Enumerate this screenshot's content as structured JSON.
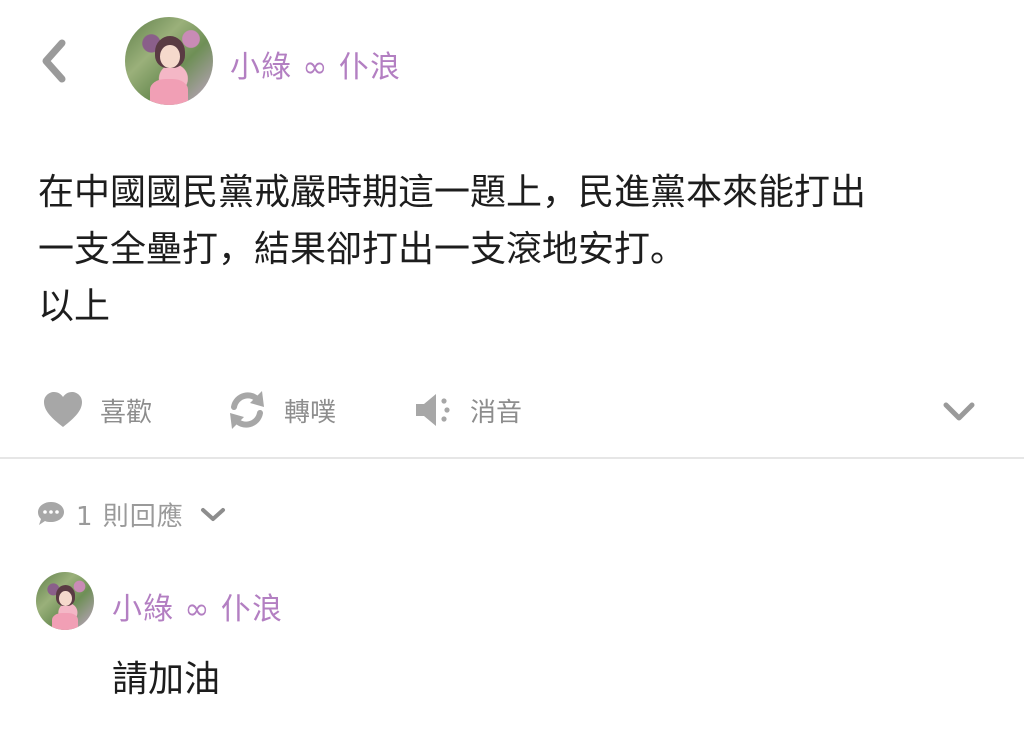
{
  "header": {
    "back_icon": "chevron-left-icon",
    "username": "小綠 ∞ 仆浪"
  },
  "post": {
    "lines": [
      "在中國國民黨戒嚴時期這一題上，民進黨本來能打出",
      "一支全壘打，結果卻打出一支滾地安打。",
      "以上"
    ]
  },
  "actions": {
    "like_label": "喜歡",
    "replurk_label": "轉噗",
    "mute_label": "消音",
    "like_icon": "heart-icon",
    "replurk_icon": "refresh-icon",
    "mute_icon": "speaker-mute-icon",
    "more_icon": "chevron-down-icon"
  },
  "replies": {
    "count_label": "1 則回應",
    "icon": "speech-bubble-icon",
    "items": [
      {
        "username": "小綠 ∞ 仆浪",
        "text": "請加油"
      }
    ]
  },
  "colors": {
    "username": "#b37fc2",
    "icon_gray": "#9a9a9a",
    "text": "#1d1d1d",
    "divider": "#e6e6e6"
  }
}
